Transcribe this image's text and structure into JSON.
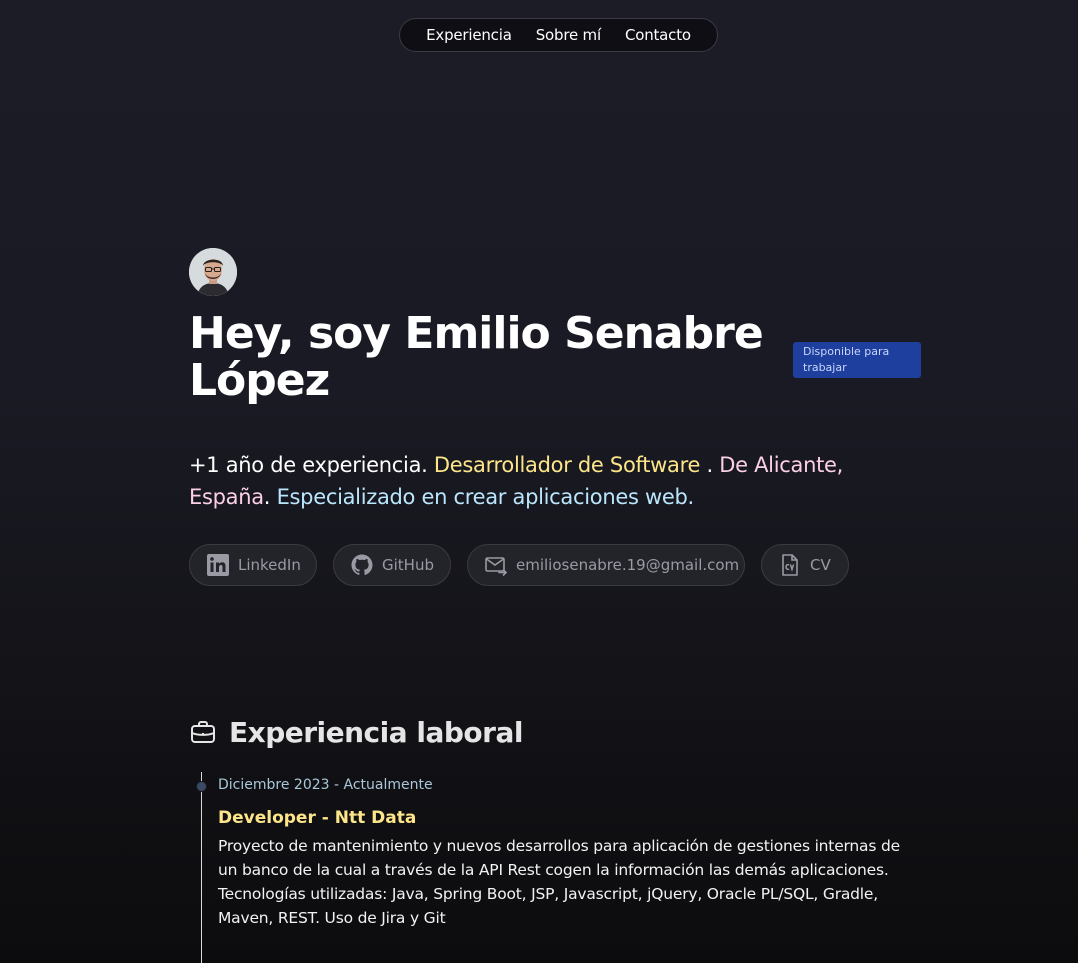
{
  "nav": {
    "items": [
      "Experiencia",
      "Sobre mí",
      "Contacto"
    ]
  },
  "hero": {
    "headline": "Hey, soy Emilio Senabre López",
    "badge": "Disponible para trabajar",
    "intro": {
      "part1": "+1 año de experiencia. ",
      "role": "Desarrollador de Software",
      "part2": " . ",
      "location": "De Alicante, España",
      "part3": ". ",
      "specialty": "Especializado en crear aplicaciones web."
    }
  },
  "links": {
    "linkedin": "LinkedIn",
    "github": "GitHub",
    "email": "emiliosenabre.19@gmail.com",
    "cv": "CV"
  },
  "experience": {
    "title": "Experiencia laboral",
    "jobs": [
      {
        "date": "Diciembre 2023 - Actualmente",
        "title": "Developer - Ntt Data",
        "description": "Proyecto de mantenimiento y nuevos desarrollos para aplicación de gestiones internas de un banco de la cual a través de la API Rest cogen la información las demás aplicaciones. Tecnologías utilizadas: Java, Spring Boot, JSP, Javascript, jQuery, Oracle PL/SQL, Gradle, Maven, REST. Uso de Jira y Git"
      }
    ]
  },
  "colors": {
    "accent_yellow": "#fde68a",
    "accent_pink": "#fbcfe8",
    "accent_blue": "#bae6fd",
    "badge_bg": "#1e3f9e"
  }
}
